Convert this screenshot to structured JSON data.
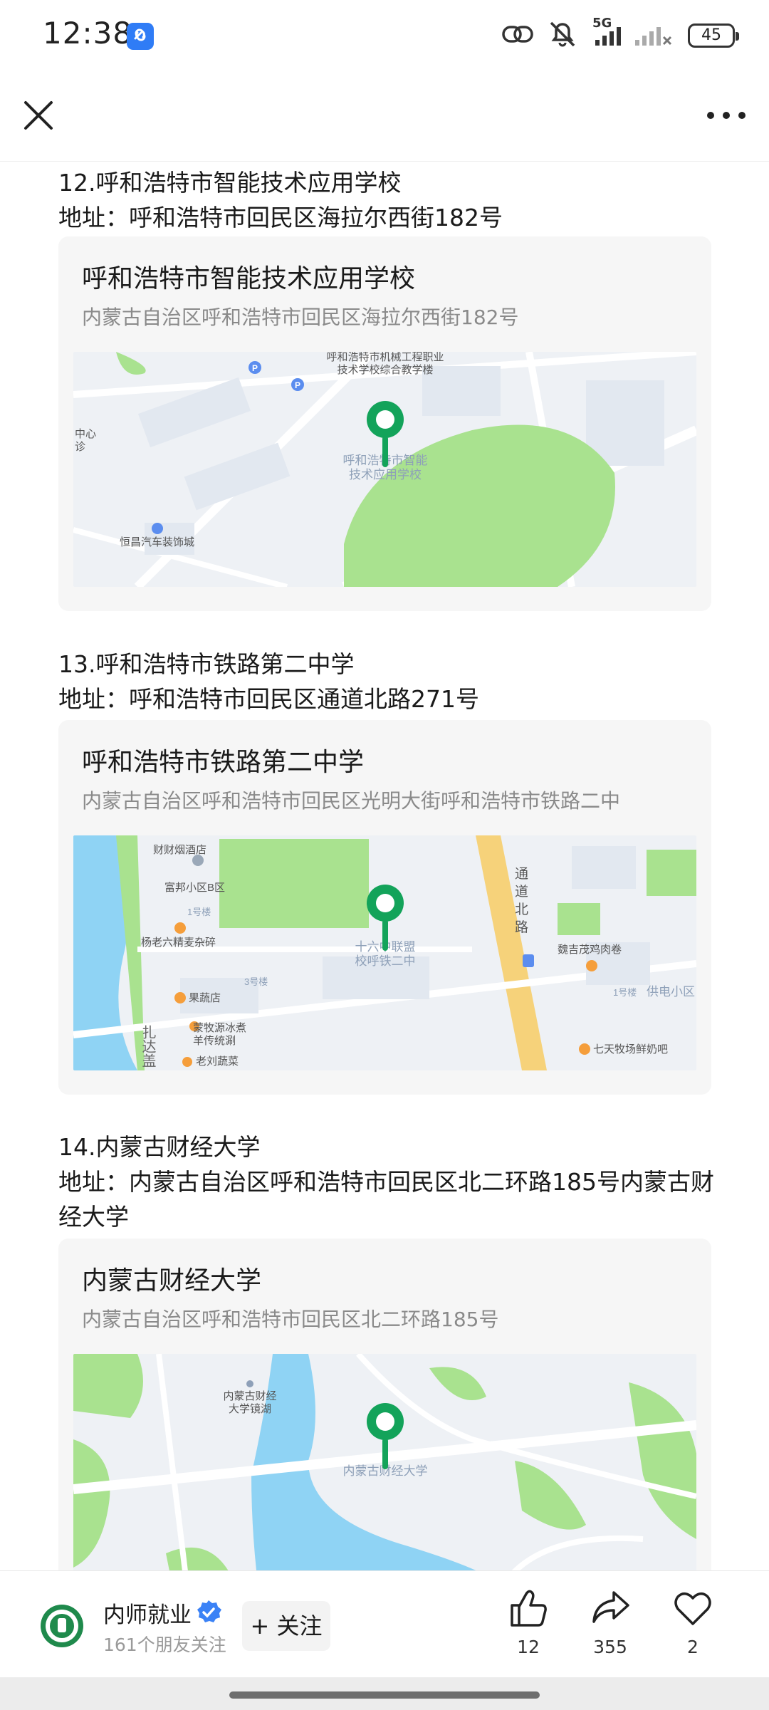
{
  "status_bar": {
    "time": "12:38",
    "network": "5G",
    "battery": "45",
    "icons": [
      "link-icon",
      "mute-icon",
      "signal-icon",
      "battery-icon"
    ]
  },
  "top_bar": {
    "close_icon": "close-icon",
    "more_icon": "more-icon"
  },
  "entries": [
    {
      "title": "12.呼和浩特市智能技术应用学校",
      "address": "地址：呼和浩特市回民区海拉尔西街182号",
      "card": {
        "name": "呼和浩特市智能技术应用学校",
        "address": "内蒙古自治区呼和浩特市回民区海拉尔西街182号",
        "map_labels": [
          "呼和浩特市机械工程职业",
          "技术学校综合教学楼",
          "呼和浩特市智能",
          "技术应用学校",
          "中心",
          "诊",
          "恒昌汽车装饰城"
        ]
      }
    },
    {
      "title": "13.呼和浩特市铁路第二中学",
      "address": "地址：呼和浩特市回民区通道北路271号",
      "card": {
        "name": "呼和浩特市铁路第二中学",
        "address": "内蒙古自治区呼和浩特市回民区光明大街呼和浩特市铁路二中",
        "map_labels": [
          "财财烟酒店",
          "富邦小区B区",
          "1号楼",
          "杨老六精麦杂碎",
          "十六中联盟",
          "校呼铁二中",
          "3号楼",
          "果蔬店",
          "蒙牧源冰煮",
          "羊传统涮",
          "老刘蔬菜",
          "扎达盖",
          "通",
          "道",
          "北",
          "路",
          "魏吉茂鸡肉卷",
          "1号楼",
          "供电小区",
          "七天牧场鲜奶吧"
        ]
      }
    },
    {
      "title": "14.内蒙古财经大学",
      "address": "地址：内蒙古自治区呼和浩特市回民区北二环路185号内蒙古财经大学",
      "card": {
        "name": "内蒙古财经大学",
        "address": "内蒙古自治区呼和浩特市回民区北二环路185号",
        "map_labels": [
          "内蒙古财经",
          "大学镜湖",
          "内蒙古财经大学"
        ]
      }
    }
  ],
  "bottom_bar": {
    "account_name": "内师就业",
    "followers": "161个朋友关注",
    "follow_label": "+ 关注",
    "likes": "12",
    "shares": "355",
    "favorites": "2",
    "colors": {
      "verified": "#3b82f6",
      "avatar": "#1f8a4c",
      "map_pin": "#13a35a",
      "map_park": "#a9e28f",
      "map_water": "#8fd3f4"
    }
  }
}
